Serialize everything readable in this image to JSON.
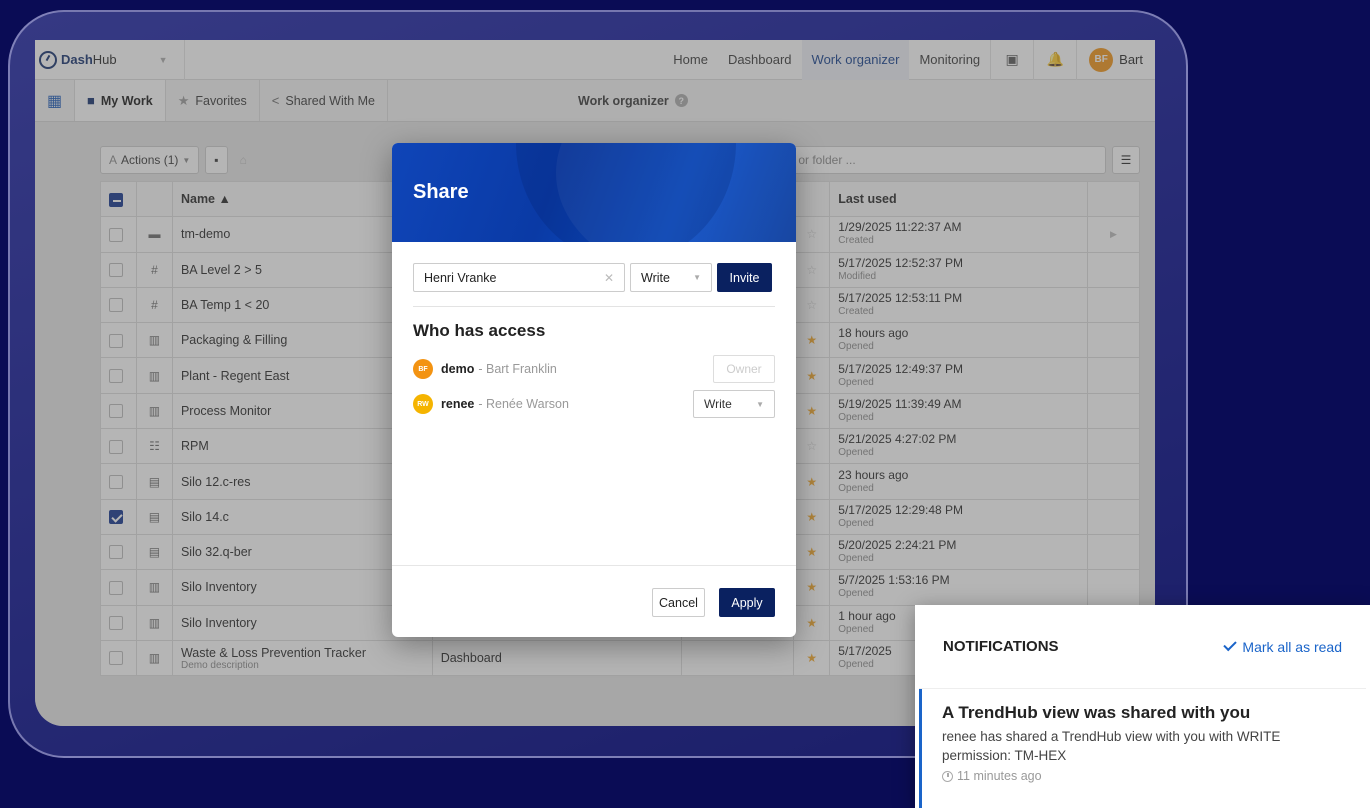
{
  "app": {
    "name_bold": "Dash",
    "name_light": "Hub"
  },
  "nav": {
    "links": [
      "Home",
      "Dashboard",
      "Work organizer",
      "Monitoring"
    ],
    "active": "Work organizer",
    "help_icon": "help-icon",
    "bell_icon": "bell-icon",
    "user": {
      "initials": "BF",
      "name": "Bart",
      "color": "#f39312"
    }
  },
  "tabs": {
    "items": [
      "My Work",
      "Favorites",
      "Shared With Me"
    ],
    "center_title": "Work organizer"
  },
  "toolbar": {
    "actions_label": "Actions (1)",
    "search_placeholder": "m or folder ..."
  },
  "table": {
    "headers": {
      "name": "Name ▲",
      "last_used": "Last used"
    },
    "rows": [
      {
        "name": "tm-demo",
        "icon": "folder-icon",
        "type": "",
        "checked": false,
        "fav": false,
        "last": "1/29/2025 11:22:37 AM",
        "action": "Created"
      },
      {
        "name": "BA Level 2 > 5",
        "icon": "hash-icon",
        "type": "",
        "checked": false,
        "fav": false,
        "last": "5/17/2025 12:52:37 PM",
        "action": "Modified"
      },
      {
        "name": "BA Temp 1 < 20",
        "icon": "hash-icon",
        "type": "",
        "checked": false,
        "fav": false,
        "last": "5/17/2025 12:53:11 PM",
        "action": "Created"
      },
      {
        "name": "Packaging & Filling",
        "icon": "chart-icon",
        "type": "",
        "checked": false,
        "fav": true,
        "last": "18 hours ago",
        "action": "Opened"
      },
      {
        "name": "Plant - Regent East",
        "icon": "chart-icon",
        "type": "",
        "checked": false,
        "fav": true,
        "last": "5/17/2025 12:49:37 PM",
        "action": "Opened"
      },
      {
        "name": "Process Monitor",
        "icon": "chart-icon",
        "type": "",
        "checked": false,
        "fav": true,
        "last": "5/19/2025 11:39:49 AM",
        "action": "Opened"
      },
      {
        "name": "RPM",
        "icon": "grid-icon",
        "type": "",
        "checked": false,
        "fav": false,
        "last": "5/21/2025 4:27:02 PM",
        "action": "Opened"
      },
      {
        "name": "Silo 12.c-res",
        "icon": "layout-icon",
        "type": "",
        "checked": false,
        "fav": true,
        "last": "23 hours ago",
        "action": "Opened"
      },
      {
        "name": "Silo 14.c",
        "icon": "layout-icon",
        "type": "",
        "checked": true,
        "fav": true,
        "last": "5/17/2025 12:29:48 PM",
        "action": "Opened"
      },
      {
        "name": "Silo 32.q-ber",
        "icon": "layout-icon",
        "type": "",
        "checked": false,
        "fav": true,
        "last": "5/20/2025 2:24:21 PM",
        "action": "Opened"
      },
      {
        "name": "Silo Inventory",
        "icon": "chart-icon",
        "type": "",
        "checked": false,
        "fav": true,
        "last": "5/7/2025 1:53:16 PM",
        "action": "Opened"
      },
      {
        "name": "Silo Inventory",
        "icon": "chart-icon",
        "type": "",
        "checked": false,
        "fav": true,
        "last": "1 hour ago",
        "action": "Opened"
      },
      {
        "name": "Waste & Loss Prevention Tracker",
        "desc": "Demo description",
        "icon": "chart-icon",
        "type": "Dashboard",
        "checked": false,
        "fav": true,
        "last": "5/17/2025",
        "action": "Opened"
      }
    ]
  },
  "share": {
    "title": "Share",
    "person": "Henri Vranke",
    "permission": "Write",
    "invite_label": "Invite",
    "who_title": "Who has access",
    "access": [
      {
        "initials": "RF",
        "user": "demo",
        "fullname": "- Bart Franklin",
        "role": "Owner",
        "color": "#f39312"
      },
      {
        "initials": "RW",
        "user": "renee",
        "fullname": "- Renée Warson",
        "role": "Write",
        "color": "#f5b400"
      }
    ],
    "cancel_label": "Cancel",
    "apply_label": "Apply"
  },
  "notifications": {
    "title": "NOTIFICATIONS",
    "mark_all": "Mark all as read",
    "item": {
      "heading": "A TrendHub view was shared with you",
      "body": "renee has shared a TrendHub view with you with WRITE permission: TM-HEX",
      "time": "11 minutes ago"
    }
  }
}
